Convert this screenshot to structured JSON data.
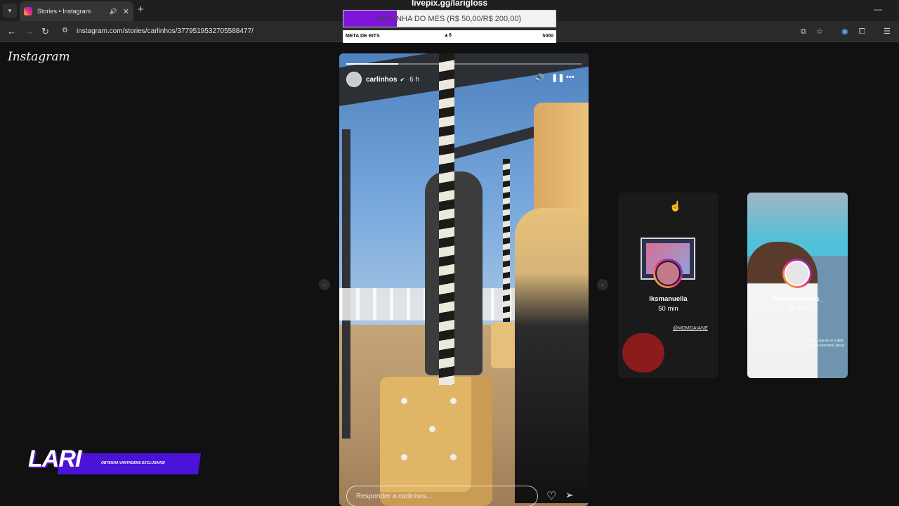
{
  "browser": {
    "tab_title": "Stories • Instagram",
    "tab_audio_icon": "speaker-icon",
    "tab_close": "✕",
    "new_tab": "+",
    "url": "instagram.com/stories/carlinhos/3779519532705588477/",
    "window_minimize": "—"
  },
  "overlay": {
    "top_title": "livepix.gg/larigloss",
    "goal_label": "METINHA DO MES (R$ 50,00/R$ 200,00)",
    "goal_progress": 0.25,
    "bits_label": "META DE BITS",
    "bits_current": "6",
    "bits_goal": "5000",
    "accent": "#7d14d8"
  },
  "instagram": {
    "logo": "Instagram",
    "story": {
      "username": "carlinhos",
      "verified_icon": "verified-icon",
      "time": "6 h",
      "progress": 0.22,
      "reply_placeholder": "Responder a carlinhos..."
    },
    "previews": [
      {
        "username": "lksmanuella",
        "time": "50 min",
        "tag": "@MDMDAIANE"
      },
      {
        "username": "theodossantos_",
        "time": "50 min",
        "caption": "O dia que eu vi o dele quase encontrei Jesus"
      }
    ]
  },
  "stream_overlay": {
    "brand": "LARI",
    "tagline": "OBTENHA VANTAGENS EXCLUSIVAS!",
    "brand_color": "#4b12d8"
  }
}
